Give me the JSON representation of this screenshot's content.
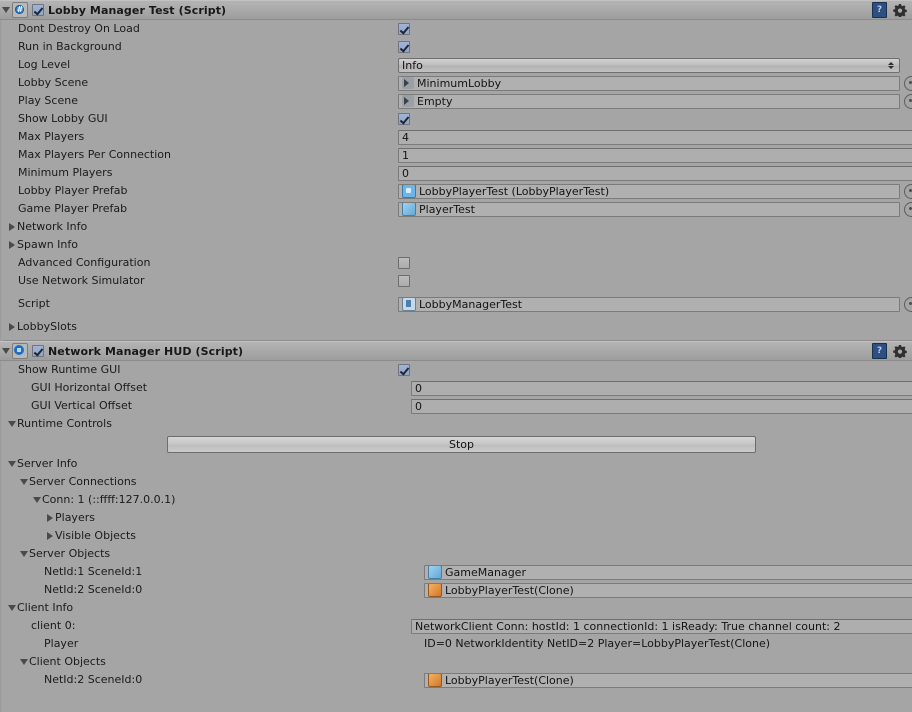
{
  "components": [
    {
      "icon": "csharp-script-icon",
      "title": "Lobby Manager Test (Script)",
      "enabled": true,
      "expanded": true,
      "help_icon": "help-book-icon",
      "settings_icon": "gear-icon"
    },
    {
      "icon": "network-hud-icon",
      "title": "Network Manager HUD (Script)",
      "enabled": true,
      "expanded": true,
      "help_icon": "help-book-icon",
      "settings_icon": "gear-icon"
    }
  ],
  "lobby_manager": {
    "dont_destroy_on_load": {
      "label": "Dont Destroy On Load",
      "checked": true
    },
    "run_in_background": {
      "label": "Run in Background",
      "checked": true
    },
    "log_level": {
      "label": "Log Level",
      "value": "Info"
    },
    "lobby_scene": {
      "label": "Lobby Scene",
      "value": "MinimumLobby",
      "icon": "scene-asset-icon"
    },
    "play_scene": {
      "label": "Play Scene",
      "value": "Empty",
      "icon": "scene-asset-icon"
    },
    "show_lobby_gui": {
      "label": "Show Lobby GUI",
      "checked": true
    },
    "max_players": {
      "label": "Max Players",
      "value": "4"
    },
    "max_players_per_connection": {
      "label": "Max Players Per Connection",
      "value": "1"
    },
    "minimum_players": {
      "label": "Minimum Players",
      "value": "0"
    },
    "lobby_player_prefab": {
      "label": "Lobby Player Prefab",
      "value": "LobbyPlayerTest (LobbyPlayerTest)",
      "icon": "prefab-script-icon"
    },
    "game_player_prefab": {
      "label": "Game Player Prefab",
      "value": "PlayerTest",
      "icon": "prefab-cube-blue-icon"
    },
    "network_info": {
      "label": "Network Info",
      "expanded": false
    },
    "spawn_info": {
      "label": "Spawn Info",
      "expanded": false
    },
    "advanced_configuration": {
      "label": "Advanced Configuration",
      "checked": false
    },
    "use_network_simulator": {
      "label": "Use Network Simulator",
      "checked": false
    },
    "script": {
      "label": "Script",
      "value": "LobbyManagerTest",
      "icon": "script-asset-icon"
    },
    "lobby_slots": {
      "label": "LobbySlots",
      "expanded": false
    }
  },
  "network_hud": {
    "show_runtime_gui": {
      "label": "Show Runtime GUI",
      "checked": true
    },
    "gui_horizontal_offset": {
      "label": "GUI Horizontal Offset",
      "value": "0"
    },
    "gui_vertical_offset": {
      "label": "GUI Vertical Offset",
      "value": "0"
    },
    "runtime_controls": {
      "label": "Runtime Controls",
      "expanded": true
    },
    "stop_button": {
      "label": "Stop"
    },
    "server_info": {
      "label": "Server Info",
      "expanded": true
    },
    "server_connections": {
      "label": "Server Connections",
      "expanded": true
    },
    "conn": {
      "label": "Conn: 1 (::ffff:127.0.0.1)",
      "expanded": true
    },
    "players": {
      "label": "Players",
      "expanded": false
    },
    "visible_objects": {
      "label": "Visible Objects",
      "expanded": false
    },
    "server_objects": {
      "label": "Server Objects",
      "expanded": true
    },
    "server_obj_1": {
      "label": "NetId:1 SceneId:1",
      "value": "GameManager",
      "icon": "prefab-cube-blue-icon"
    },
    "server_obj_2": {
      "label": "NetId:2 SceneId:0",
      "value": "LobbyPlayerTest(Clone)",
      "icon": "prefab-cube-orange-icon"
    },
    "client_info": {
      "label": "Client Info",
      "expanded": true
    },
    "client_0": {
      "label": "client 0:",
      "value": "NetworkClient Conn: hostId: 1 connectionId: 1 isReady: True channel count: 2"
    },
    "client_player": {
      "label": "Player",
      "value": "ID=0 NetworkIdentity NetID=2 Player=LobbyPlayerTest(Clone)"
    },
    "client_objects": {
      "label": "Client Objects",
      "expanded": true
    },
    "client_obj_1": {
      "label": "NetId:2 SceneId:0",
      "value": "LobbyPlayerTest(Clone)",
      "icon": "prefab-cube-orange-icon"
    }
  }
}
